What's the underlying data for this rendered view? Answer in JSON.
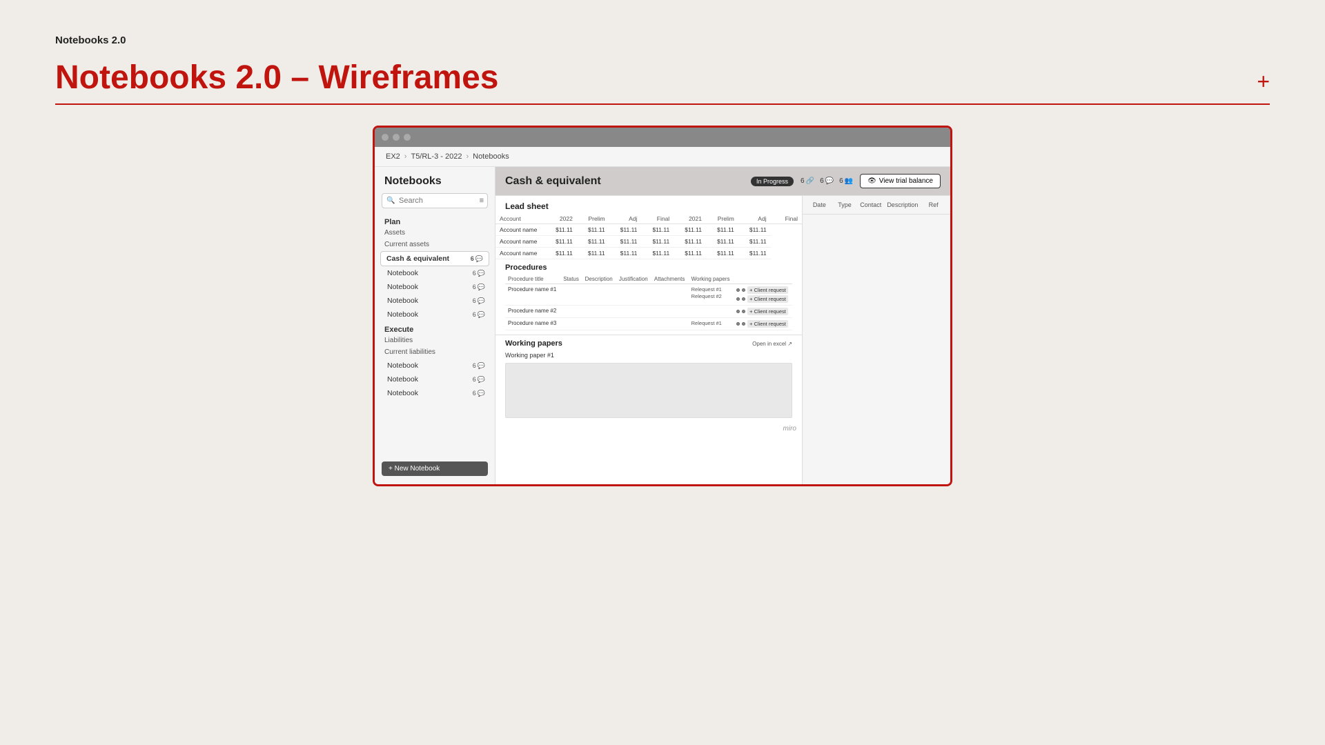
{
  "page": {
    "meta_title": "Notebooks 2.0",
    "main_title": "Notebooks 2.0 – Wireframes",
    "add_button_label": "+",
    "miro_label": "miro"
  },
  "breadcrumb": {
    "items": [
      "EX2",
      "T5/RL-3 - 2022",
      "Notebooks"
    ]
  },
  "sidebar": {
    "title": "Notebooks",
    "search_placeholder": "Search",
    "plan_label": "Plan",
    "assets_label": "Assets",
    "current_assets_label": "Current assets",
    "active_notebook": "Cash & equivalent",
    "active_badge": "6",
    "notebooks": [
      {
        "name": "Notebook",
        "badge": "6"
      },
      {
        "name": "Notebook",
        "badge": "6"
      },
      {
        "name": "Notebook",
        "badge": "6"
      },
      {
        "name": "Notebook",
        "badge": "6"
      }
    ],
    "execute_label": "Execute",
    "liabilities_label": "Liabilities",
    "current_liabilities_label": "Current liabilities",
    "execute_notebooks": [
      {
        "name": "Notebook",
        "badge": "6"
      },
      {
        "name": "Notebook",
        "badge": "6"
      },
      {
        "name": "Notebook",
        "badge": "6"
      }
    ],
    "new_notebook_btn": "+ New Notebook"
  },
  "notebook": {
    "title": "Cash & equivalent",
    "status": "In Progress",
    "stat1": "6",
    "stat1_icon": "link",
    "stat2": "6",
    "stat2_icon": "comment",
    "stat3": "6",
    "stat3_icon": "person",
    "view_trial_btn": "View trial balance"
  },
  "lead_sheet": {
    "title": "Lead sheet",
    "columns": {
      "right_panel": [
        "Date",
        "Type",
        "Contact",
        "Description",
        "Ref"
      ]
    },
    "table": {
      "headers": [
        "Account",
        "2022",
        "Prelim",
        "Adj",
        "Final",
        "2021",
        "Prelim",
        "Adj",
        "Final"
      ],
      "rows": [
        [
          "Account name",
          "$11.11",
          "$11.11",
          "$11.11",
          "$11.11",
          "$11.11",
          "$11.11",
          "$11.11"
        ],
        [
          "Account name",
          "$11.11",
          "$11.11",
          "$11.11",
          "$11.11",
          "$11.11",
          "$11.11",
          "$11.11"
        ],
        [
          "Account name",
          "$11.11",
          "$11.11",
          "$11.11",
          "$11.11",
          "$11.11",
          "$11.11",
          "$11.11"
        ]
      ]
    }
  },
  "procedures": {
    "title": "Procedures",
    "headers": [
      "Procedure title",
      "Status",
      "Description",
      "Justification",
      "Attachments",
      "Working papers"
    ],
    "rows": [
      {
        "title": "Procedure name #1",
        "links": [
          "Relequest #1",
          "Relequest #2"
        ],
        "client_requests": [
          "+ Client request",
          "+ Client request"
        ]
      },
      {
        "title": "Procedure name #2",
        "links": [],
        "client_requests": [
          "+ Client request"
        ]
      },
      {
        "title": "Procedure name #3",
        "links": [
          "Relequest #1"
        ],
        "client_requests": [
          "+ Client request"
        ]
      }
    ]
  },
  "working_papers": {
    "title": "Working papers",
    "open_link": "Open in excel ↗",
    "item": "Working paper #1"
  }
}
